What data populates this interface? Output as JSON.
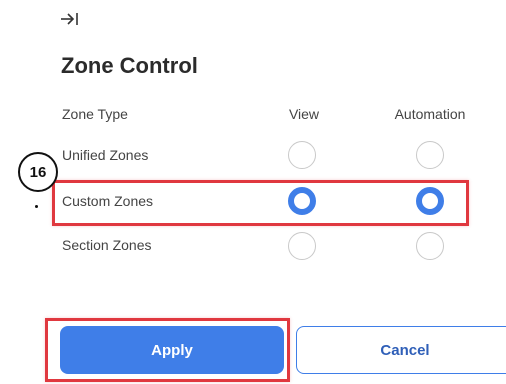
{
  "header": {
    "collapse_icon": "collapse-right-icon",
    "title": "Zone Control"
  },
  "columns": {
    "zone_type": "Zone Type",
    "view": "View",
    "automation": "Automation"
  },
  "rows": [
    {
      "label": "Unified Zones",
      "view_checked": false,
      "automation_checked": false
    },
    {
      "label": "Custom Zones",
      "view_checked": true,
      "automation_checked": true
    },
    {
      "label": "Section Zones",
      "view_checked": false,
      "automation_checked": false
    }
  ],
  "annotation": {
    "step_number": "16",
    "highlight_color": "#e0383f"
  },
  "actions": {
    "apply_label": "Apply",
    "cancel_label": "Cancel"
  },
  "colors": {
    "accent": "#3f7ee8",
    "text": "#444444",
    "title": "#2b2b2b",
    "radio_border": "#c9c9c9"
  }
}
